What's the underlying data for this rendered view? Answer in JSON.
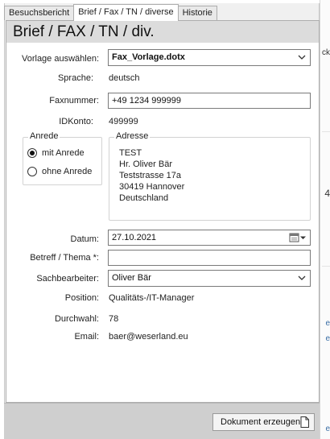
{
  "tabs": [
    {
      "label": "Besuchsbericht",
      "active": false
    },
    {
      "label": "Brief / Fax / TN / diverse",
      "active": true
    },
    {
      "label": "Historie",
      "active": false
    }
  ],
  "form_title": "Brief / FAX / TN / div.",
  "vorlage": {
    "label": "Vorlage auswählen:",
    "value": "Fax_Vorlage.dotx"
  },
  "sprache": {
    "label": "Sprache:",
    "value": "deutsch"
  },
  "faxnummer": {
    "label": "Faxnummer:",
    "value": "+49 1234 999999"
  },
  "idkonto": {
    "label": "IDKonto:",
    "value": "499999"
  },
  "anrede": {
    "caption": "Anrede",
    "options": [
      {
        "label": "mit Anrede",
        "checked": true
      },
      {
        "label": "ohne Anrede",
        "checked": false
      }
    ]
  },
  "adresse": {
    "caption": "Adresse",
    "lines": [
      "TEST",
      "Hr. Oliver Bär",
      "Teststrasse 17a",
      "30419 Hannover",
      "Deutschland"
    ]
  },
  "datum": {
    "label": "Datum:",
    "value": "27.10.2021"
  },
  "betreff": {
    "label": "Betreff / Thema *:",
    "value": ""
  },
  "sachbearbeiter": {
    "label": "Sachbearbeiter:",
    "value": "Oliver Bär"
  },
  "position": {
    "label": "Position:",
    "value": "Qualitäts-/IT-Manager"
  },
  "durchwahl": {
    "label": "Durchwahl:",
    "value": "78"
  },
  "email": {
    "label": "Email:",
    "value": "baer@weserland.eu"
  },
  "button_label": "Dokument erzeugen",
  "background_fragments": [
    "ck",
    "4",
    "e",
    "e",
    "e"
  ]
}
